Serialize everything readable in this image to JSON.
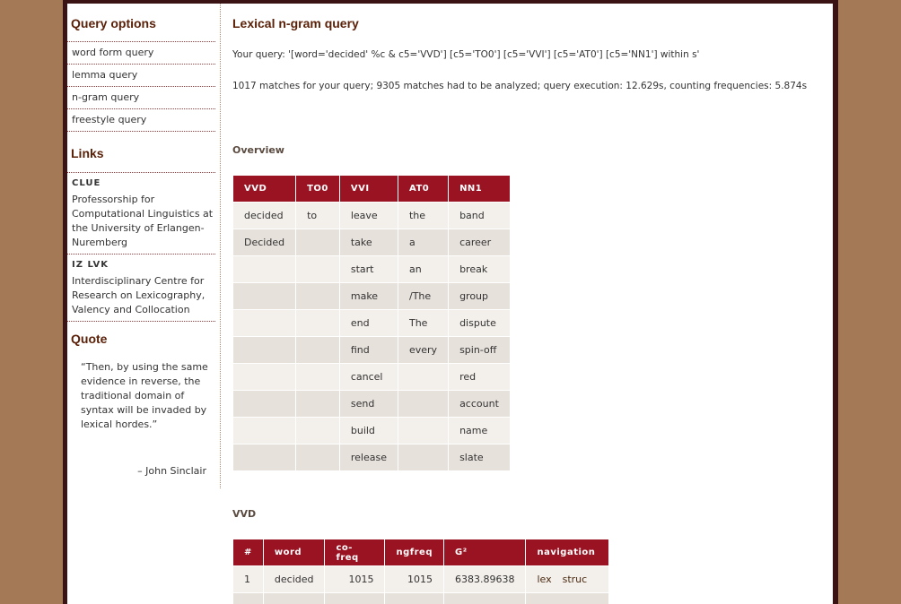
{
  "sidebar": {
    "options_title": "Query options",
    "options": [
      "word form query",
      "lemma query",
      "n-gram query",
      "freestyle query"
    ],
    "links_title": "Links",
    "links": [
      {
        "name": "CLUE",
        "desc": "Professorship for Computational Linguistics at the University of Erlangen-Nuremberg"
      },
      {
        "name": "IZ LVK",
        "desc": "Interdisciplinary Centre for Research on Lexicography, Valency and Collocation"
      }
    ],
    "quote_title": "Quote",
    "quote_text": "“Then, by using the same evidence in reverse, the traditional domain of syntax will be invaded by lexical hordes.”",
    "quote_author": "– John Sinclair"
  },
  "main": {
    "title": "Lexical n-gram query",
    "query_line": "Your query: '[word='decided' %c & c5='VVD'] [c5='TO0'] [c5='VVI'] [c5='AT0'] [c5='NN1'] within s'",
    "stats_line": "1017 matches for your query; 9305 matches had to be analyzed; query execution: 12.629s, counting frequencies: 5.874s",
    "overview_title": "Overview",
    "overview_headers": [
      "VVD",
      "TO0",
      "VVI",
      "AT0",
      "NN1"
    ],
    "overview_rows": [
      [
        "decided",
        "to",
        "leave",
        "the",
        "band"
      ],
      [
        "Decided",
        "",
        "take",
        "a",
        "career"
      ],
      [
        "",
        "",
        "start",
        "an",
        "break"
      ],
      [
        "",
        "",
        "make",
        "/The",
        "group"
      ],
      [
        "",
        "",
        "end",
        "The",
        "dispute"
      ],
      [
        "",
        "",
        "find",
        "every",
        "spin-off"
      ],
      [
        "",
        "",
        "cancel",
        "",
        "red"
      ],
      [
        "",
        "",
        "send",
        "",
        "account"
      ],
      [
        "",
        "",
        "build",
        "",
        "name"
      ],
      [
        "",
        "",
        "release",
        "",
        "slate"
      ]
    ],
    "vvd_title": "VVD",
    "vvd_headers": [
      "#",
      "word",
      "co-freq",
      "ngfreq",
      "G²",
      "navigation"
    ],
    "vvd_rows": [
      {
        "n": "1",
        "word": "decided",
        "cofreq": "1015",
        "ngfreq": "1015",
        "g2": "6383.89638",
        "nav": [
          "lex",
          "struc"
        ]
      }
    ]
  }
}
